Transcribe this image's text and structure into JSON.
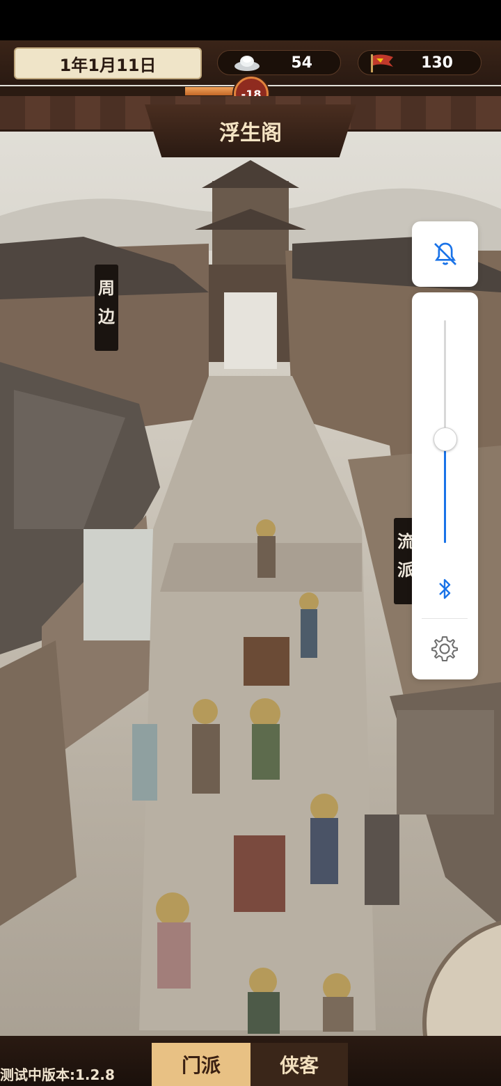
{
  "top": {
    "date": "1年1月11日",
    "silver": "54",
    "flags": "130",
    "progress_badge": "-18",
    "progress_percent": 26
  },
  "location": {
    "title": "浮生阁"
  },
  "side_tags": [
    {
      "chars": [
        "周",
        "边"
      ]
    },
    {
      "chars": [
        "流",
        "派"
      ]
    }
  ],
  "system_panel": {
    "bell_icon": "bell-off-icon",
    "volume_percent": 47,
    "bluetooth_icon": "bluetooth-icon",
    "settings_icon": "gear-icon",
    "accent": "#1a73e8"
  },
  "bottom": {
    "version": "测试中版本:1.2.8",
    "tabs": [
      {
        "label": "门派",
        "active": true
      },
      {
        "label": "侠客",
        "active": false
      }
    ]
  }
}
